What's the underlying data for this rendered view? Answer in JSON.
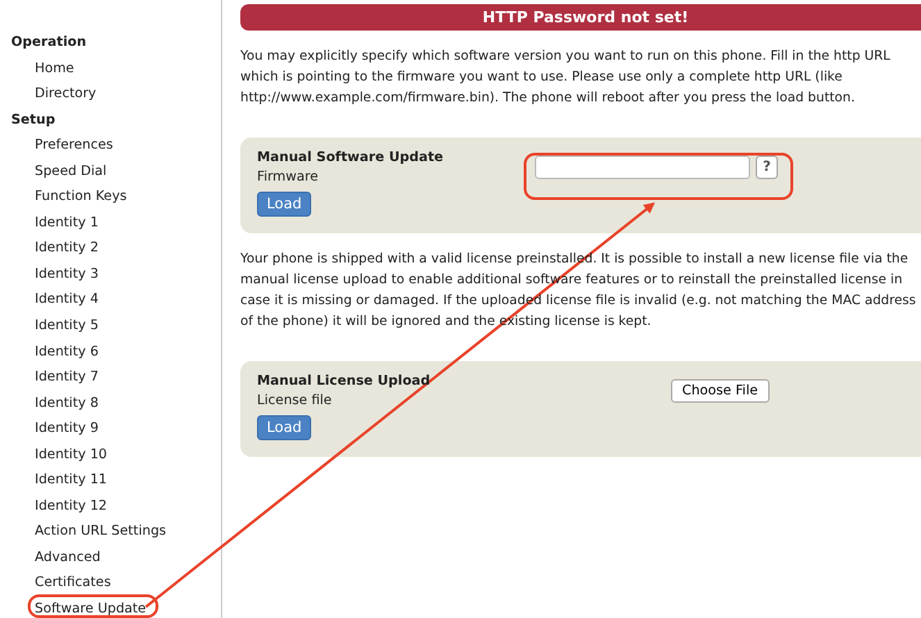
{
  "banner": "HTTP Password not set!",
  "sidebar": [
    {
      "heading": "Operation",
      "items": [
        "Home",
        "Directory"
      ]
    },
    {
      "heading": "Setup",
      "items": [
        "Preferences",
        "Speed Dial",
        "Function Keys",
        "Identity 1",
        "Identity 2",
        "Identity 3",
        "Identity 4",
        "Identity 5",
        "Identity 6",
        "Identity 7",
        "Identity 8",
        "Identity 9",
        "Identity 10",
        "Identity 11",
        "Identity 12",
        "Action URL Settings",
        "Advanced",
        "Certificates",
        "Software Update"
      ]
    }
  ],
  "intro": "You may explicitly specify which software version you want to run on this phone. Fill in the http URL which is pointing to the firmware you want to use. Please use only a complete http URL (like http://www.example.com/firmware.bin). The phone will reboot after you press the load button.",
  "software_panel": {
    "title": "Manual Software Update",
    "label": "Firmware",
    "help": "?",
    "button": "Load"
  },
  "license_text": "Your phone is shipped with a valid license preinstalled. It is possible to install a new license file via the manual license upload to enable additional software features or to reinstall the preinstalled license in case it is missing or damaged. If the uploaded license file is invalid (e.g. not matching the MAC address of the phone) it will be ignored and the existing license is kept.",
  "license_panel": {
    "title": "Manual License Upload",
    "label": "License file",
    "file_button": "Choose File",
    "button": "Load"
  }
}
